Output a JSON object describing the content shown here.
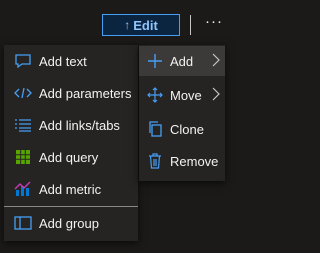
{
  "toolbar": {
    "edit_label": "Edit",
    "edit_icon": "up-arrow-icon",
    "more_label": "···"
  },
  "main_menu": {
    "items": [
      {
        "label": "Add",
        "icon": "plus-icon",
        "has_submenu": true
      },
      {
        "label": "Move",
        "icon": "move-icon",
        "has_submenu": true
      },
      {
        "label": "Clone",
        "icon": "clone-icon",
        "has_submenu": false
      },
      {
        "label": "Remove",
        "icon": "trash-icon",
        "has_submenu": false
      }
    ]
  },
  "add_submenu": {
    "items": [
      {
        "label": "Add text",
        "icon": "text-icon"
      },
      {
        "label": "Add parameters",
        "icon": "parameters-icon"
      },
      {
        "label": "Add links/tabs",
        "icon": "links-tabs-icon"
      },
      {
        "label": "Add query",
        "icon": "grid-icon"
      },
      {
        "label": "Add metric",
        "icon": "metric-chart-icon"
      },
      {
        "label": "Add group",
        "icon": "group-icon"
      }
    ]
  },
  "colors": {
    "background": "#1b1a19",
    "menu_background": "#252423",
    "accent": "#479ef5",
    "active_item": "#3b3a39",
    "query_icon": "#57a300",
    "text": "#f3f2f1"
  }
}
